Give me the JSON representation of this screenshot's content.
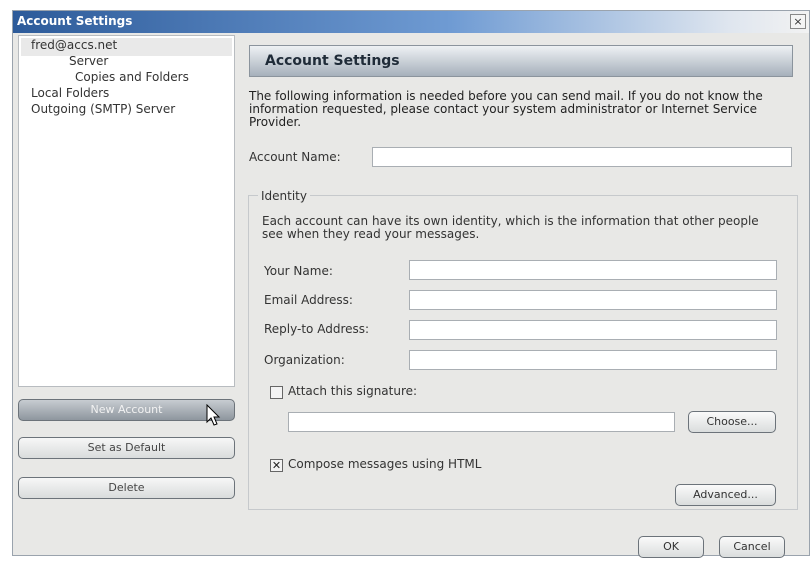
{
  "window": {
    "title": "Account Settings",
    "close_glyph": "×"
  },
  "tree": {
    "items": [
      {
        "label": "fred@accs.net"
      },
      {
        "label": "Server"
      },
      {
        "label": "Copies and Folders"
      },
      {
        "label": "Local Folders"
      },
      {
        "label": "Outgoing (SMTP) Server"
      }
    ]
  },
  "left_buttons": {
    "new_account": "New Account",
    "set_default": "Set as Default",
    "delete": "Delete"
  },
  "main": {
    "header": "Account Settings",
    "intro": "The following information is needed before you can send mail. If you do not know the information requested, please contact your system administrator or Internet Service Provider.",
    "account_name_label": "Account Name:",
    "account_name_value": ""
  },
  "identity": {
    "group_label": "Identity",
    "description": "Each account can have its own identity, which is the information that other people see when they read your messages.",
    "fields": {
      "your_name": {
        "label": "Your Name:",
        "value": ""
      },
      "email": {
        "label": "Email Address:",
        "value": ""
      },
      "reply_to": {
        "label": "Reply-to Address:",
        "value": ""
      },
      "organization": {
        "label": "Organization:",
        "value": ""
      }
    },
    "attach_signature": {
      "label": "Attach this signature:",
      "checked": false,
      "mark": ""
    },
    "signature_path": "",
    "choose_button": "Choose...",
    "compose_html": {
      "label": "Compose messages using HTML",
      "checked": true,
      "mark": "✕"
    },
    "advanced_button": "Advanced..."
  },
  "footer": {
    "ok": "OK",
    "cancel": "Cancel"
  },
  "icons": {
    "close": "close-icon",
    "cursor": "mouse-pointer-icon",
    "check": "checkmark-icon"
  }
}
